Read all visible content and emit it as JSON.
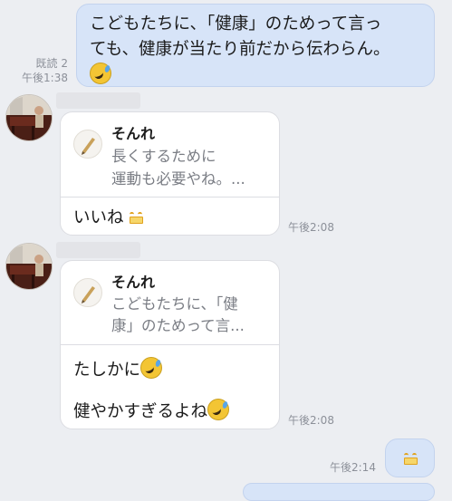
{
  "messages": {
    "m1": {
      "line1": "こどもたちに、「健康」のためって言っ",
      "line2": "ても、健康が当たり前だから伝わらん。",
      "read": "既読 2",
      "time": "午後1:38"
    },
    "m2": {
      "reply_name": "そんれ",
      "reply_line1": "長くするために",
      "reply_line2": "運動も必要やね。...",
      "text": "いいね",
      "time": "午後2:08"
    },
    "m3": {
      "reply_name": "そんれ",
      "reply_line1": "こどもたちに、「健",
      "reply_line2": "康」のためって言...",
      "text1": "たしかに",
      "text2": "健やかすぎるよね",
      "time": "午後2:08"
    },
    "m4": {
      "time": "午後2:14"
    }
  },
  "icons": {
    "laugh": "laughing-crying-emoji-icon",
    "grin": "grimace-emoji-icon",
    "pen": "pen-icon"
  },
  "colors": {
    "background": "#eceef2",
    "outgoing_bubble": "#d7e4f8",
    "incoming_bubble": "#ffffff",
    "meta_text": "#8c9099"
  }
}
